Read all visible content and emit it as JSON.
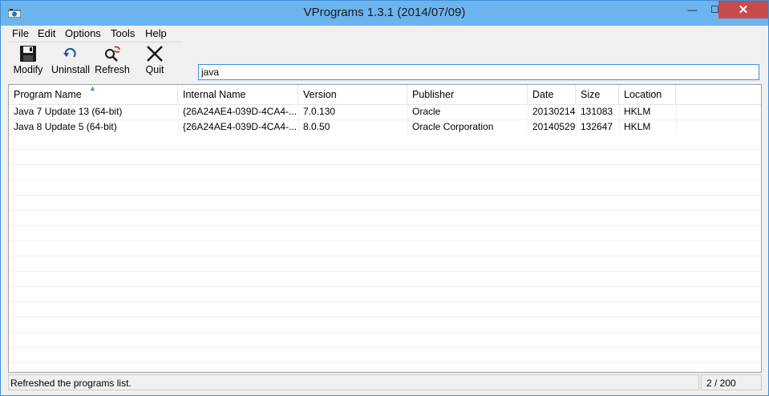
{
  "window": {
    "title": "VPrograms 1.3.1 (2014/07/09)",
    "controls": {
      "minimize": "—",
      "maximize": "☐",
      "close": "✕"
    }
  },
  "menu": [
    "File",
    "Edit",
    "Options",
    "Tools",
    "Help"
  ],
  "toolbar": [
    {
      "label": "Modify",
      "icon": "floppy-disk-icon"
    },
    {
      "label": "Uninstall",
      "icon": "undo-arrow-icon"
    },
    {
      "label": "Refresh",
      "icon": "magnifier-refresh-icon"
    },
    {
      "label": "Quit",
      "icon": "x-mark-icon"
    }
  ],
  "search": {
    "value": "java"
  },
  "table": {
    "columns": [
      "Program Name",
      "Internal Name",
      "Version",
      "Publisher",
      "Date",
      "Size",
      "Location"
    ],
    "rows": [
      [
        "Java 7 Update 13 (64-bit)",
        "{26A24AE4-039D-4CA4-...",
        "7.0.130",
        "Oracle",
        "20130214",
        "131083",
        "HKLM"
      ],
      [
        "Java 8 Update 5 (64-bit)",
        "{26A24AE4-039D-4CA4-...",
        "8.0.50",
        "Oracle Corporation",
        "20140529",
        "132647",
        "HKLM"
      ]
    ]
  },
  "status": {
    "message": "Refreshed the programs list.",
    "count": "2 / 200"
  },
  "colors": {
    "titlebar": "#6cb4ee",
    "close": "#c74b4b",
    "focus": "#3c8fd8"
  }
}
